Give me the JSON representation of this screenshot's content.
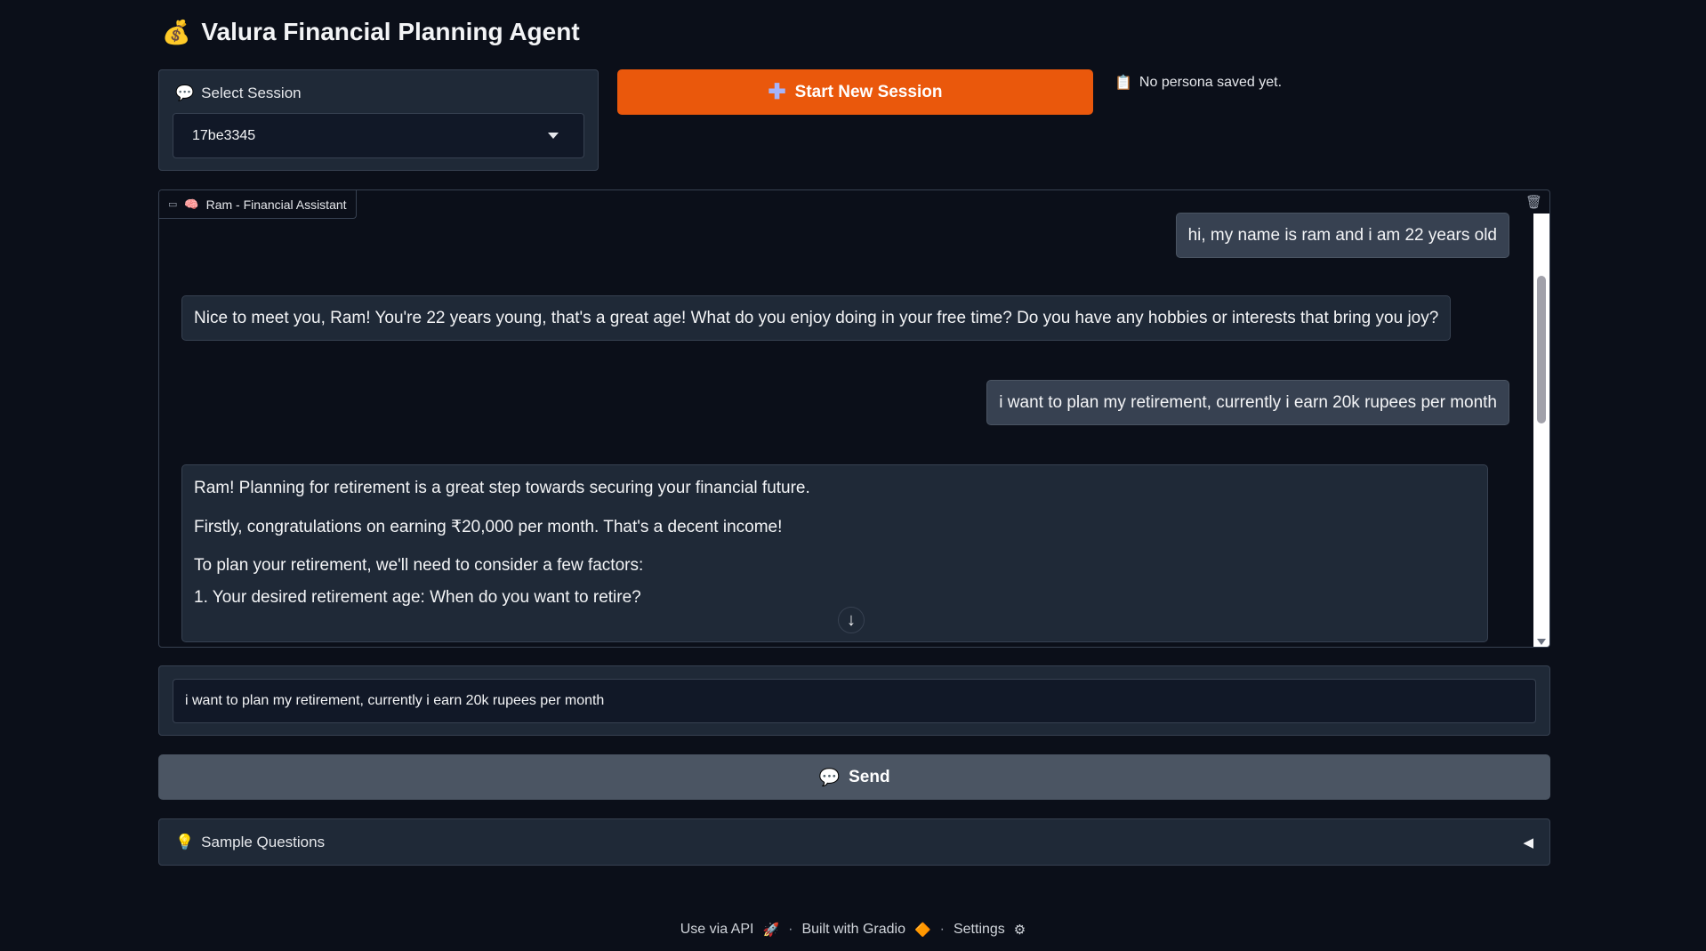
{
  "app": {
    "title": "Valura Financial Planning Agent",
    "title_icon": "💰"
  },
  "session": {
    "label": "Select Session",
    "label_icon": "💬",
    "selected": "17be3345",
    "new_session_label": "Start New Session",
    "persona_icon": "📋",
    "persona_status": "No persona saved yet."
  },
  "chat": {
    "tag_label": "Ram - Financial Assistant",
    "tag_icon": "🧠",
    "messages": [
      {
        "role": "user",
        "text": "hi, my name is ram and i am 22 years old"
      },
      {
        "role": "assistant",
        "text": "Nice to meet you, Ram! You're 22 years young, that's a great age! What do you enjoy doing in your free time? Do you have any hobbies or interests that bring you joy?"
      },
      {
        "role": "user",
        "text": "i want to plan my retirement, currently i earn 20k rupees per month"
      },
      {
        "role": "assistant",
        "lines": [
          "Ram! Planning for retirement is a great step towards securing your financial future.",
          "Firstly, congratulations on earning ₹20,000 per month. That's a decent income!",
          "To plan your retirement, we'll need to consider a few factors:",
          "1. Your desired retirement age: When do you want to retire?"
        ]
      }
    ],
    "scroll_down_glyph": "↓"
  },
  "input": {
    "value": "i want to plan my retirement, currently i earn 20k rupees per month"
  },
  "send": {
    "label": "Send",
    "icon": "💬"
  },
  "accordion": {
    "label": "Sample Questions",
    "icon": "💡",
    "toggle": "◀"
  },
  "footer": {
    "api": "Use via API",
    "api_icon": "🚀",
    "gradio": "Built with Gradio",
    "gradio_icon": "🔶",
    "settings": "Settings",
    "settings_icon": "⚙",
    "separator": "·"
  },
  "colors": {
    "background": "#0b0f19",
    "primary_button": "#ea580c",
    "secondary_button": "#4b5563",
    "panel": "#1f2937"
  }
}
